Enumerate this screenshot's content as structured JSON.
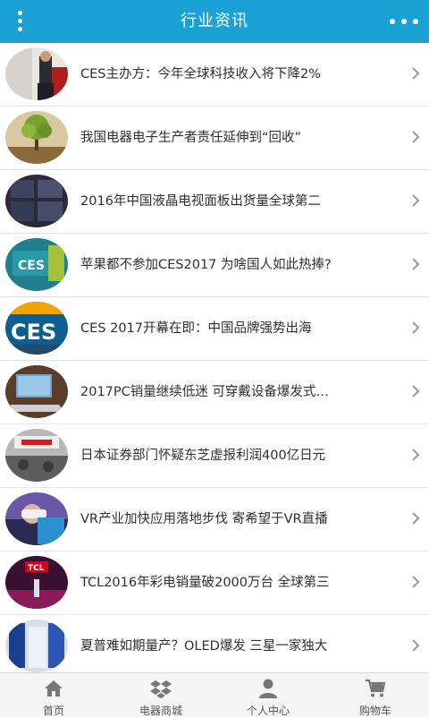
{
  "header": {
    "title": "行业资讯"
  },
  "news": [
    {
      "title": "CES主办方：今年全球科技收入将下降2%",
      "thumb_icon": "speaker-photo"
    },
    {
      "title": "我国电器电子生产者责任延伸到“回收”",
      "thumb_icon": "tree-photo"
    },
    {
      "title": "2016年中国液晶电视面板出货量全球第二",
      "thumb_icon": "panel-photo"
    },
    {
      "title": "苹果都不参加CES2017 为啥国人如此热捧?",
      "thumb_icon": "ces-sign-photo"
    },
    {
      "title": "CES 2017开幕在即：中国品牌强势出海",
      "thumb_icon": "ces-logo-photo"
    },
    {
      "title": "2017PC销量继续低迷 可穿戴设备爆发式…",
      "thumb_icon": "laptop-photo"
    },
    {
      "title": "日本证券部门怀疑东芝虚报利润400亿日元",
      "thumb_icon": "toshiba-photo"
    },
    {
      "title": "VR产业加快应用落地步伐 寄希望于VR直播",
      "thumb_icon": "vr-headset-photo"
    },
    {
      "title": "TCL2016年彩电销量破2000万台 全球第三",
      "thumb_icon": "tcl-stage-photo"
    },
    {
      "title": "夏普难如期量产？OLED爆发 三星一家独大",
      "thumb_icon": "samsung-booth-photo"
    }
  ],
  "tabbar": [
    {
      "label": "首页",
      "icon": "home-icon"
    },
    {
      "label": "电器商城",
      "icon": "dropbox-icon"
    },
    {
      "label": "个人中心",
      "icon": "user-icon"
    },
    {
      "label": "购物车",
      "icon": "cart-icon"
    }
  ],
  "colors": {
    "header_bg": "#1aa1d6",
    "tabbar_bg": "#f5f5f5",
    "text": "#2f2f2f",
    "chevron": "#9a9a9a"
  }
}
